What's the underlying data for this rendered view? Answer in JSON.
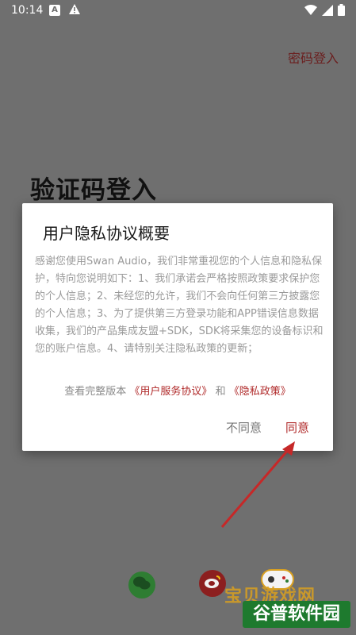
{
  "status_bar": {
    "time": "10:14",
    "icons": [
      "a-notification-icon",
      "warning-icon",
      "wifi-icon",
      "signal-icon",
      "battery-icon"
    ]
  },
  "header": {
    "password_login": "密码登入"
  },
  "page": {
    "heading": "验证码登入"
  },
  "dialog": {
    "title": "用户隐私协议概要",
    "body": "感谢您使用Swan Audio，我们非常重视您的个人信息和隐私保护，特向您说明如下：1、我们承诺会严格按照政策要求保护您的个人信息；2、未经您的允许，我们不会向任何第三方披露您的个人信息；3、为了提供第三方登录功能和APP错误信息数据收集，我们的产品集成友盟+SDK，SDK将采集您的设备标识和您的账户信息。4、请特别关注隐私政策的更新；",
    "links_prefix": "查看完整版本",
    "user_agreement": "《用户服务协议》",
    "links_and": "和",
    "privacy_policy": "《隐私政策》",
    "disagree": "不同意",
    "agree": "同意"
  },
  "social": {
    "icons": [
      "wechat-icon",
      "weibo-icon"
    ]
  },
  "watermark": {
    "top_text": "宝贝游戏网",
    "box_text": "谷普软件园"
  },
  "colors": {
    "accent": "#b02a2a",
    "overlay": "#6f6f6f",
    "dialog_bg": "#ffffff"
  }
}
